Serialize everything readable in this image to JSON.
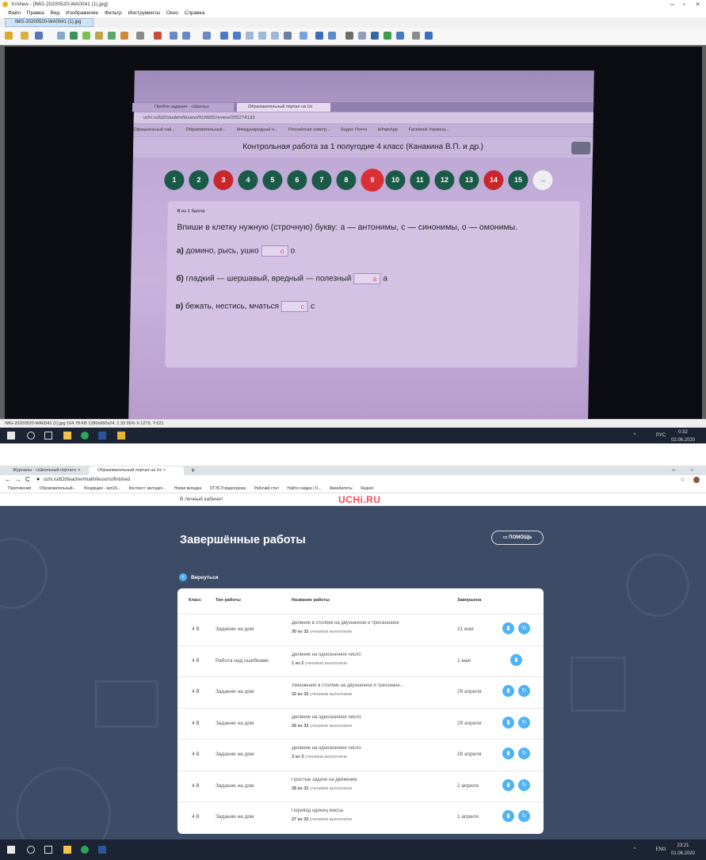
{
  "xnview": {
    "title": "XnView - [IMG-20200520-WA0041 (1).jpg]",
    "menu": [
      "Файл",
      "Правка",
      "Вид",
      "Изображение",
      "Фильтр",
      "Инструменты",
      "Окно",
      "Справка"
    ],
    "tab": "IMG-20200520-WA0041 (1).jpg",
    "status": "IMG-20200520-WA0041 (1).jpg  164.78 KB  1280x960x24, 1.33  95%  X:1279, Y:621",
    "photo": {
      "tab1": "Пройти задание - «Школьн",
      "tab2": "Образовательный портал на Uc",
      "url": "uchi.ru/b2t/student/lesson/916695/review/205274133",
      "bookmarks": [
        "Официальный сай...",
        "Образовательный...",
        "Международный н...",
        "Российская электр...",
        "Видео Почта",
        "WhatsApp",
        "Facebook Украина..."
      ],
      "header": "Контрольная работа за 1 полугодие 4 класс (Канакина В.П. и др.)",
      "numbers": [
        "1",
        "2",
        "3",
        "4",
        "5",
        "6",
        "7",
        "8",
        "9",
        "10",
        "11",
        "12",
        "13",
        "14",
        "15"
      ],
      "number_colors": [
        "#1b5a46",
        "#1b5a46",
        "#c8272d",
        "#1b5a46",
        "#1b5a46",
        "#1b5a46",
        "#1b5a46",
        "#1b5a46",
        "#d93038",
        "#1b5a46",
        "#1b5a46",
        "#1b5a46",
        "#1b5a46",
        "#c8272d",
        "#1b5a46"
      ],
      "score": "0",
      "score_suffix": "из 1 балла",
      "question": "Впиши в клетку нужную (строчную) букву: а — антонимы, с — синонимы, о — омонимы.",
      "a_label": "а)",
      "a_text": "домино, рысь, ушко",
      "a_ans": "о",
      "a_correct": "о",
      "b_label": "б)",
      "b_text": "гладкий — шершавый, вредный — полезный",
      "b_ans": "а",
      "b_correct": "а",
      "c_label": "в)",
      "c_text": "бежать, нестись, мчаться",
      "c_ans": "с",
      "c_correct": "с"
    },
    "tray": {
      "lang": "РУС",
      "time": "0:32",
      "date": "02.06.2020"
    }
  },
  "chrome": {
    "tab1": "Журналы - «Школьный портал»",
    "tab2": "Образовательный портал на Uc",
    "url": "uchi.ru/b2t/teacher/math/lessons/finished",
    "bookmarks": [
      "Приложения",
      "Образовательный...",
      "Входящие - lam15...",
      "Контекст: методич...",
      "Новая вкладка",
      "ОГЭСЭ видеоуроки",
      "Рабочий стол",
      "Найти скидки | О...",
      "Авиабилеты",
      "Яндекс"
    ]
  },
  "uchi": {
    "cabinet": "В личный кабинет",
    "logo": "UCHi.RU",
    "title": "Завершённые работы",
    "help": "ПОМОЩЬ",
    "back": "Вернуться",
    "headers": {
      "cls": "Класс",
      "type": "Тип работы",
      "name": "Название работы",
      "done": "Завершена"
    },
    "rows": [
      {
        "cls": "4 В",
        "type": "Задание на дом",
        "name": "Деление в столбик на двузначное и трёхзначное",
        "done_text": "из",
        "count_a": "30",
        "count_b": "32",
        "sub": "учеников выполнили",
        "date": "21 мая",
        "two": true
      },
      {
        "cls": "4 В",
        "type": "Работа над ошибками",
        "name": "Деление на однозначное число",
        "done_text": "из",
        "count_a": "1",
        "count_b": "2",
        "sub": "учеников выполнили",
        "date": "1 мая",
        "two": false
      },
      {
        "cls": "4 В",
        "type": "Задание на дом",
        "name": "Умножение в столбик на двузначное и трёхзначн...",
        "done_text": "из",
        "count_a": "32",
        "count_b": "32",
        "sub": "учеников выполнили",
        "date": "29 апреля",
        "two": true
      },
      {
        "cls": "4 В",
        "type": "Задание на дом",
        "name": "Деление на однозначное число",
        "done_text": "из",
        "count_a": "29",
        "count_b": "32",
        "sub": "учеников выполнили",
        "date": "29 апреля",
        "two": true
      },
      {
        "cls": "4 В",
        "type": "Задание на дом",
        "name": "Деление на однозначное число",
        "done_text": "из",
        "count_a": "3",
        "count_b": "3",
        "sub": "учеников выполнили",
        "date": "28 апреля",
        "two": true
      },
      {
        "cls": "4 В",
        "type": "Задание на дом",
        "name": "Простые задачи на движение",
        "done_text": "из",
        "count_a": "28",
        "count_b": "32",
        "sub": "учеников выполнили",
        "date": "2 апреля",
        "two": true
      },
      {
        "cls": "4 В",
        "type": "Задание на дом",
        "name": "Перевод единиц массы",
        "done_text": "из",
        "count_a": "27",
        "count_b": "32",
        "sub": "учеников выполнили",
        "date": "1 апреля",
        "two": true
      }
    ],
    "tray": {
      "lang": "ENG",
      "time": "23:21",
      "date": "01.06.2020"
    }
  }
}
